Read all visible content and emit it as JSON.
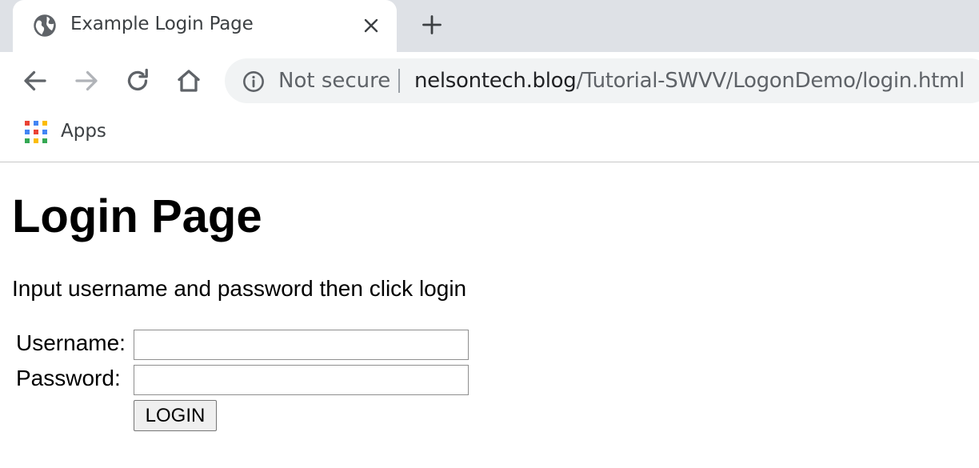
{
  "browser": {
    "tab": {
      "title": "Example Login Page",
      "icon": "globe-icon"
    },
    "toolbar": {
      "back_icon": "back-arrow-icon",
      "forward_icon": "forward-arrow-icon",
      "reload_icon": "reload-icon",
      "home_icon": "home-icon"
    },
    "omnibox": {
      "security_icon": "info-icon",
      "security_label": "Not secure",
      "url_host": "nelsontech.blog",
      "url_path": "/Tutorial-SWVV/LogonDemo/login.html"
    },
    "bookmarks": {
      "apps_label": "Apps",
      "apps_icon": "apps-grid-icon"
    }
  },
  "page": {
    "heading": "Login Page",
    "instructions": "Input username and password then click login",
    "form": {
      "username_label": "Username:",
      "username_value": "",
      "password_label": "Password:",
      "password_value": "",
      "login_button": "LOGIN"
    }
  },
  "colors": {
    "tabstrip": "#dee1e6",
    "omnibox": "#f1f3f4",
    "url_host": "#202124",
    "url_path": "#5f6368",
    "apps_grid": [
      "#ea4335",
      "#4285f4",
      "#fbbc04",
      "#34a853"
    ]
  }
}
